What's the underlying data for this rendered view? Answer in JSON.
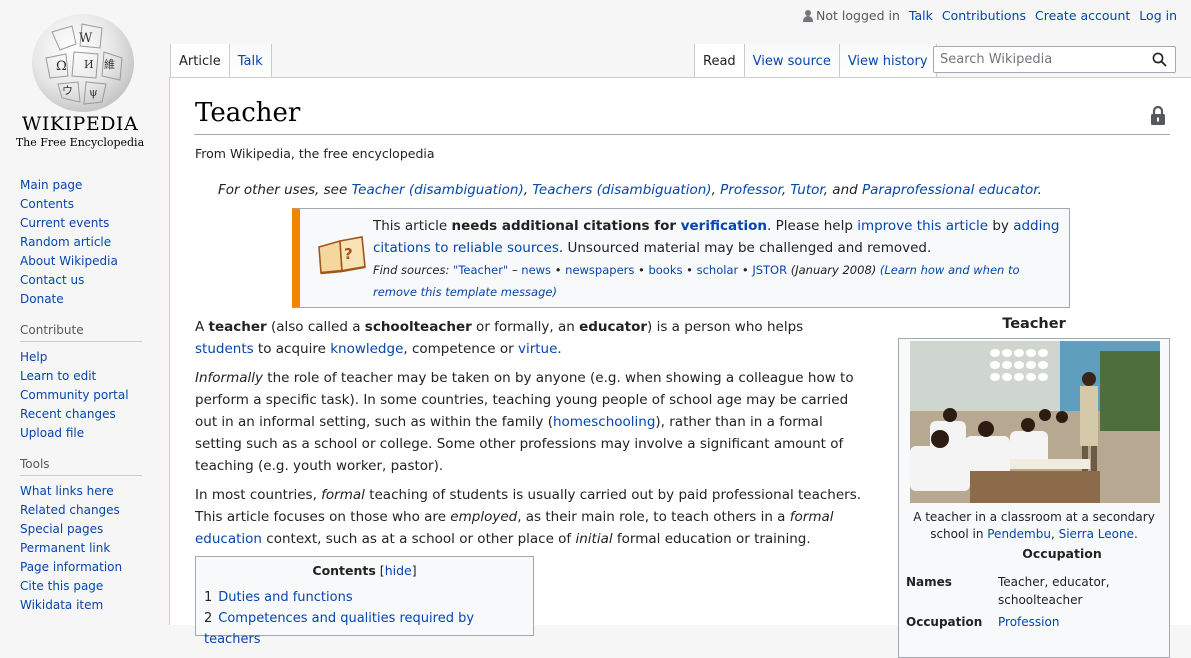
{
  "logo": {
    "wordmark": "WIKIPEDIA",
    "tagline": "The Free Encyclopedia"
  },
  "personal": {
    "not_logged_in": "Not logged in",
    "talk": "Talk",
    "contributions": "Contributions",
    "create_account": "Create account",
    "login": "Log in"
  },
  "tabs": {
    "article": "Article",
    "talk": "Talk",
    "read": "Read",
    "view_source": "View source",
    "view_history": "View history"
  },
  "search": {
    "placeholder": "Search Wikipedia"
  },
  "sidebar": {
    "nav": [
      "Main page",
      "Contents",
      "Current events",
      "Random article",
      "About Wikipedia",
      "Contact us",
      "Donate"
    ],
    "contribute_heading": "Contribute",
    "contribute": [
      "Help",
      "Learn to edit",
      "Community portal",
      "Recent changes",
      "Upload file"
    ],
    "tools_heading": "Tools",
    "tools": [
      "What links here",
      "Related changes",
      "Special pages",
      "Permanent link",
      "Page information",
      "Cite this page",
      "Wikidata item"
    ]
  },
  "page": {
    "title": "Teacher",
    "tagline": "From Wikipedia, the free encyclopedia"
  },
  "hatnote": {
    "prefix": "For other uses, see ",
    "l1": "Teacher (disambiguation)",
    "sep1": ", ",
    "l2": "Teachers (disambiguation)",
    "sep2": ", ",
    "l3": "Professor",
    "sep3": ", ",
    "l4": "Tutor",
    "sep4": ", and ",
    "l5": "Paraprofessional educator",
    "end": "."
  },
  "ambox": {
    "t1": "This article ",
    "b1": "needs additional citations for ",
    "l1": "verification",
    "t2": ". Please help ",
    "l2": "improve this article",
    "t3": " by ",
    "l3": "adding citations to reliable sources",
    "t4": ". Unsourced material may be challenged and removed.",
    "find_sources": "Find sources: ",
    "fs_q": "\"Teacher\"",
    "fs_dash": " – ",
    "news": "news",
    "dot": " • ",
    "newspapers": "newspapers",
    "books": "books",
    "scholar": "scholar",
    "jstor": "JSTOR",
    "date": " (January 2008) ",
    "learn": "(Learn how and when to remove this template message)"
  },
  "body": {
    "p1": {
      "t1": "A ",
      "b1": "teacher",
      "t2": " (also called a ",
      "b2": "schoolteacher",
      "t3": " or formally, an ",
      "b3": "educator",
      "t4": ") is a person who helps ",
      "l1": "students",
      "t5": " to acquire ",
      "l2": "knowledge",
      "t6": ", competence or ",
      "l3": "virtue",
      "t7": "."
    },
    "p2": {
      "i1": "Informally",
      "t1": " the role of teacher may be taken on by anyone (e.g. when showing a colleague how to perform a specific task). In some countries, teaching young people of school age may be carried out in an informal setting, such as within the family (",
      "l1": "homeschooling",
      "t2": "), rather than in a formal setting such as a school or college. Some other professions may involve a significant amount of teaching (e.g. youth worker, pastor)."
    },
    "p3": {
      "t1": "In most countries, ",
      "i1": "formal",
      "t2": " teaching of students is usually carried out by paid professional teachers. This article focuses on those who are ",
      "i2": "employed",
      "t3": ", as their main role, to teach others in a ",
      "i3": "formal",
      "l1": " education",
      "t4": " context, such as at a school or other place of ",
      "i4": "initial",
      "t5": " formal education or training."
    }
  },
  "toc": {
    "title": "Contents",
    "hide_open": " [",
    "hide": "hide",
    "hide_close": "]",
    "items": [
      {
        "num": "1",
        "label": "Duties and functions"
      },
      {
        "num": "2",
        "label": "Competences and qualities required by teachers"
      }
    ]
  },
  "infobox": {
    "title": "Teacher",
    "caption_t": "A teacher in a classroom at a secondary school in ",
    "caption_l1": "Pendembu",
    "caption_sep": ", ",
    "caption_l2": "Sierra Leone",
    "caption_end": ".",
    "occupation_heading": "Occupation",
    "names_label": "Names",
    "names_value": "Teacher, educator, schoolteacher",
    "occupation_label": "Occupation",
    "occupation_value": "Profession"
  },
  "colors": {
    "link": "#0645ad",
    "ambox_stripe": "#f28500",
    "border": "#a2a9b1",
    "chrome_bg": "#f6f6f6"
  }
}
